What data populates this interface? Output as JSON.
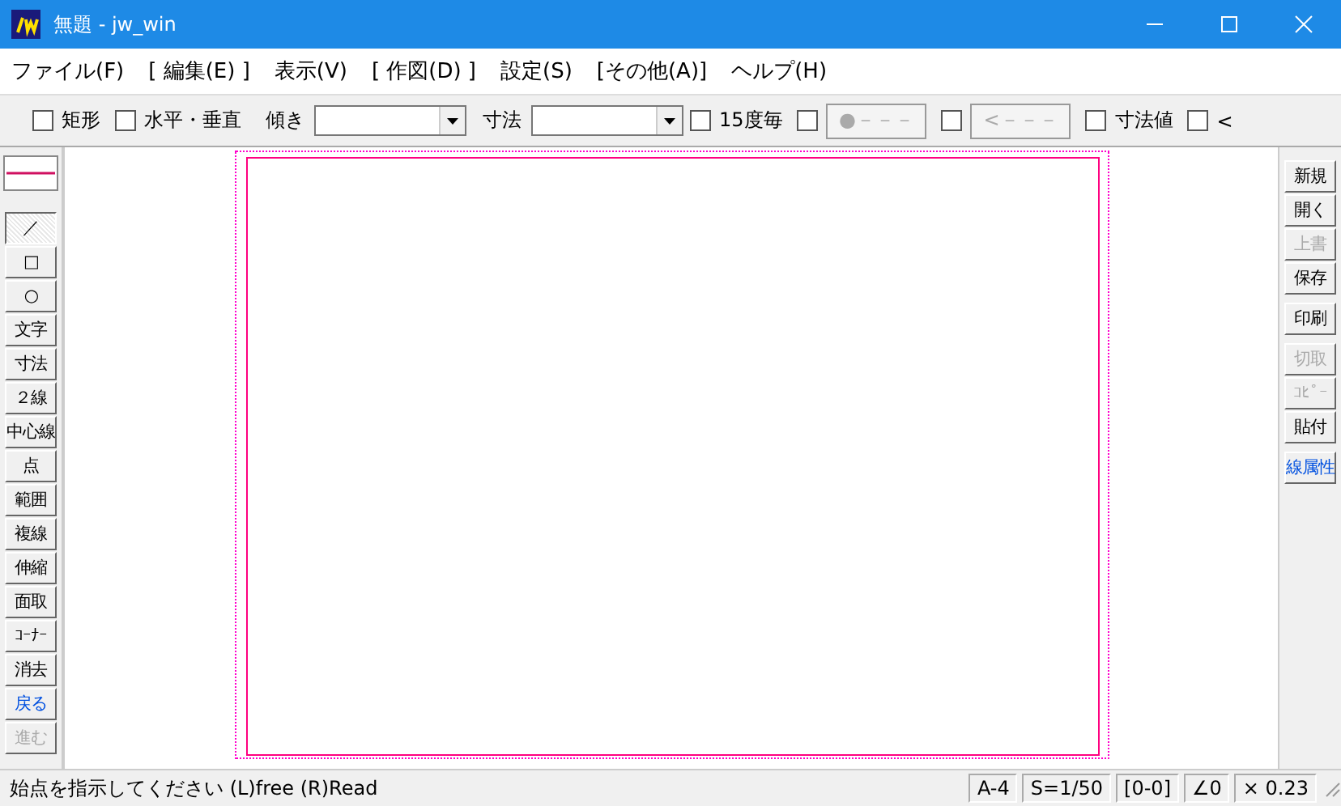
{
  "window": {
    "title": "無題 - jw_win"
  },
  "menu": [
    "ファイル(F)",
    "[ 編集(E) ]",
    "表示(V)",
    "[ 作図(D) ]",
    "設定(S)",
    "[その他(A)]",
    "ヘルプ(H)"
  ],
  "toolbar": [
    {
      "kind": "checkbox",
      "label": "矩形",
      "checked": false
    },
    {
      "kind": "checkbox",
      "label": "水平・垂直",
      "checked": false
    },
    {
      "kind": "label",
      "label": "傾き"
    },
    {
      "kind": "combo"
    },
    {
      "kind": "label",
      "label": "寸法"
    },
    {
      "kind": "combo"
    },
    {
      "kind": "checkbox",
      "label": "15度毎",
      "checked": false
    },
    {
      "kind": "checkbutton",
      "label": "●－－－",
      "checked": false,
      "disabled": true
    },
    {
      "kind": "checkbutton",
      "label": "<－－－",
      "checked": false,
      "disabled": true
    },
    {
      "kind": "checkbox",
      "label": "寸法値",
      "checked": false
    },
    {
      "kind": "checkbox",
      "label": "<",
      "checked": false
    }
  ],
  "left_tools": [
    {
      "label": "／",
      "selected": true,
      "disabled": false,
      "highlighted": false
    },
    {
      "label": "□",
      "selected": false,
      "disabled": false,
      "highlighted": false
    },
    {
      "label": "○",
      "selected": false,
      "disabled": false,
      "highlighted": false
    },
    {
      "label": "文字",
      "selected": false,
      "disabled": false,
      "highlighted": false
    },
    {
      "label": "寸法",
      "selected": false,
      "disabled": false,
      "highlighted": false
    },
    {
      "label": "２線",
      "selected": false,
      "disabled": false,
      "highlighted": false
    },
    {
      "label": "中心線",
      "selected": false,
      "disabled": false,
      "highlighted": false
    },
    {
      "label": "点",
      "selected": false,
      "disabled": false,
      "highlighted": false
    },
    {
      "label": "範囲",
      "selected": false,
      "disabled": false,
      "highlighted": false
    },
    {
      "label": "複線",
      "selected": false,
      "disabled": false,
      "highlighted": false
    },
    {
      "label": "伸縮",
      "selected": false,
      "disabled": false,
      "highlighted": false
    },
    {
      "label": "面取",
      "selected": false,
      "disabled": false,
      "highlighted": false
    },
    {
      "label": "ｺｰﾅｰ",
      "selected": false,
      "disabled": false,
      "highlighted": false
    },
    {
      "label": "消去",
      "selected": false,
      "disabled": false,
      "highlighted": false
    },
    {
      "label": "戻る",
      "selected": false,
      "disabled": false,
      "highlighted": true
    },
    {
      "label": "進む",
      "selected": false,
      "disabled": true,
      "highlighted": false
    }
  ],
  "right_tool_groups": [
    [
      {
        "label": "新規",
        "disabled": false,
        "highlighted": false
      },
      {
        "label": "開く",
        "disabled": false,
        "highlighted": false
      },
      {
        "label": "上書",
        "disabled": true,
        "highlighted": false
      },
      {
        "label": "保存",
        "disabled": false,
        "highlighted": false
      }
    ],
    [
      {
        "label": "印刷",
        "disabled": false,
        "highlighted": false
      }
    ],
    [
      {
        "label": "切取",
        "disabled": true,
        "highlighted": false
      },
      {
        "label": "ｺﾋﾟｰ",
        "disabled": true,
        "highlighted": false
      },
      {
        "label": "貼付",
        "disabled": false,
        "highlighted": false
      }
    ],
    [
      {
        "label": "線属性",
        "disabled": false,
        "highlighted": true
      }
    ]
  ],
  "status_bar": {
    "message": "始点を指示してください (L)free (R)Read",
    "cells": [
      "A-4",
      "S=1/50",
      "[0-0]",
      "∠0",
      "× 0.23"
    ]
  }
}
